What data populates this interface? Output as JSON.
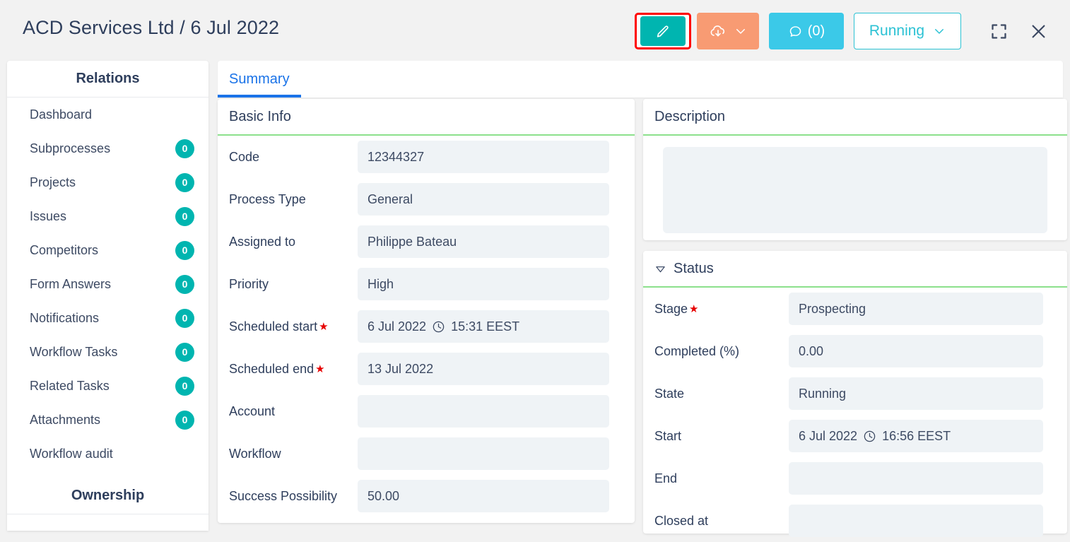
{
  "header": {
    "title": "ACD Services Ltd / 6 Jul 2022",
    "toolbar": {
      "edit_icon": "pencil-icon",
      "export_icon": "cloud-download-icon",
      "export_chevron_icon": "chevron-down-icon",
      "comment_icon": "comment-bubble-icon",
      "comment_count": "(0)",
      "status_label": "Running",
      "status_chevron_icon": "chevron-down-icon",
      "fullscreen_icon": "fullscreen-icon",
      "close_icon": "close-icon"
    }
  },
  "sidebar": {
    "title": "Relations",
    "items": [
      {
        "label": "Dashboard",
        "badge": null
      },
      {
        "label": "Subprocesses",
        "badge": "0"
      },
      {
        "label": "Projects",
        "badge": "0"
      },
      {
        "label": "Issues",
        "badge": "0"
      },
      {
        "label": "Competitors",
        "badge": "0"
      },
      {
        "label": "Form Answers",
        "badge": "0"
      },
      {
        "label": "Notifications",
        "badge": "0"
      },
      {
        "label": "Workflow Tasks",
        "badge": "0"
      },
      {
        "label": "Related Tasks",
        "badge": "0"
      },
      {
        "label": "Attachments",
        "badge": "0"
      },
      {
        "label": "Workflow audit",
        "badge": null
      }
    ],
    "section2_title": "Ownership"
  },
  "tabs": [
    {
      "label": "Summary",
      "active": true
    }
  ],
  "basic_info": {
    "title": "Basic Info",
    "fields": [
      {
        "label": "Code",
        "value": "12344327",
        "required": false,
        "clock": false,
        "time": ""
      },
      {
        "label": "Process Type",
        "value": "General",
        "required": false,
        "clock": false,
        "time": ""
      },
      {
        "label": "Assigned to",
        "value": "Philippe Bateau",
        "required": false,
        "clock": false,
        "time": ""
      },
      {
        "label": "Priority",
        "value": "High",
        "required": false,
        "clock": false,
        "time": ""
      },
      {
        "label": "Scheduled start",
        "value": "6 Jul 2022",
        "required": true,
        "clock": true,
        "time": "15:31 EEST"
      },
      {
        "label": "Scheduled end",
        "value": "13 Jul 2022",
        "required": true,
        "clock": false,
        "time": ""
      },
      {
        "label": "Account",
        "value": "",
        "required": false,
        "clock": false,
        "time": ""
      },
      {
        "label": "Workflow",
        "value": "",
        "required": false,
        "clock": false,
        "time": ""
      },
      {
        "label": "Success Possibility",
        "value": "50.00",
        "required": false,
        "clock": false,
        "time": ""
      }
    ]
  },
  "description": {
    "title": "Description",
    "value": "",
    "placeholder": ""
  },
  "status": {
    "title": "Status",
    "collapse_icon": "triangle-down-icon",
    "fields": [
      {
        "label": "Stage",
        "value": "Prospecting",
        "required": true,
        "clock": false,
        "time": ""
      },
      {
        "label": "Completed (%)",
        "value": "0.00",
        "required": false,
        "clock": false,
        "time": ""
      },
      {
        "label": "State",
        "value": "Running",
        "required": false,
        "clock": false,
        "time": ""
      },
      {
        "label": "Start",
        "value": "6 Jul 2022",
        "required": false,
        "clock": true,
        "time": "16:56 EEST"
      },
      {
        "label": "End",
        "value": "",
        "required": false,
        "clock": false,
        "time": ""
      },
      {
        "label": "Closed at",
        "value": "",
        "required": false,
        "clock": false,
        "time": ""
      }
    ]
  },
  "colors": {
    "accent_teal": "#00b5b0",
    "accent_orange": "#f89b73",
    "accent_cyan": "#3bc9e8",
    "status_border": "#2cc2d4",
    "highlight_red": "#ff0000",
    "tab_blue": "#1a73e8",
    "card_rule_green": "#8ce08c",
    "field_bg": "#eff3f6",
    "text_dark": "#2e3e5c"
  }
}
